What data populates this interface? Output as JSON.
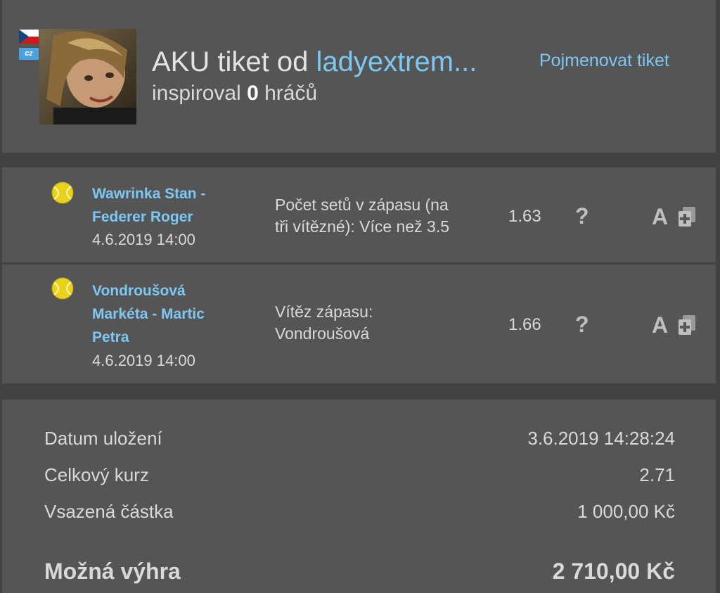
{
  "header": {
    "flag": "cz-flag",
    "language_badge": "cz",
    "title_prefix": "AKU tiket od ",
    "username": "ladyextrem...",
    "rename_link": "Pojmenovat tiket",
    "inspired_prefix": "inspiroval ",
    "inspired_count": "0",
    "inspired_suffix": " hráčů"
  },
  "bets": [
    {
      "sport_icon": "tennis-ball-icon",
      "match_line1": "Wawrinka Stan -",
      "match_line2": "Federer Roger",
      "date": "4.6.2019 14:00",
      "market_line1": "Počet setů v zápasu (na",
      "market_line2": "tři vítězné): Více než 3.5",
      "odds": "1.63",
      "help": "?",
      "a_label": "A"
    },
    {
      "sport_icon": "tennis-ball-icon",
      "match_line1": "Vondroušová",
      "match_line2": "Markéta - Martic",
      "match_line3": "Petra",
      "date": "4.6.2019 14:00",
      "market_line1": "Vítěz zápasu:",
      "market_line2": "Vondroušová",
      "odds": "1.66",
      "help": "?",
      "a_label": "A"
    }
  ],
  "summary": {
    "saved_label": "Datum uložení",
    "saved_value": "3.6.2019 14:28:24",
    "total_odds_label": "Celkový kurz",
    "total_odds_value": "2.71",
    "stake_label": "Vsazená částka",
    "stake_value": "1 000,00 Kč",
    "win_label": "Možná výhra",
    "win_value": "2 710,00 Kč"
  },
  "colors": {
    "background": "#424242",
    "panel": "#555555",
    "link": "#7ec7f2",
    "text": "#d9d9d9"
  }
}
